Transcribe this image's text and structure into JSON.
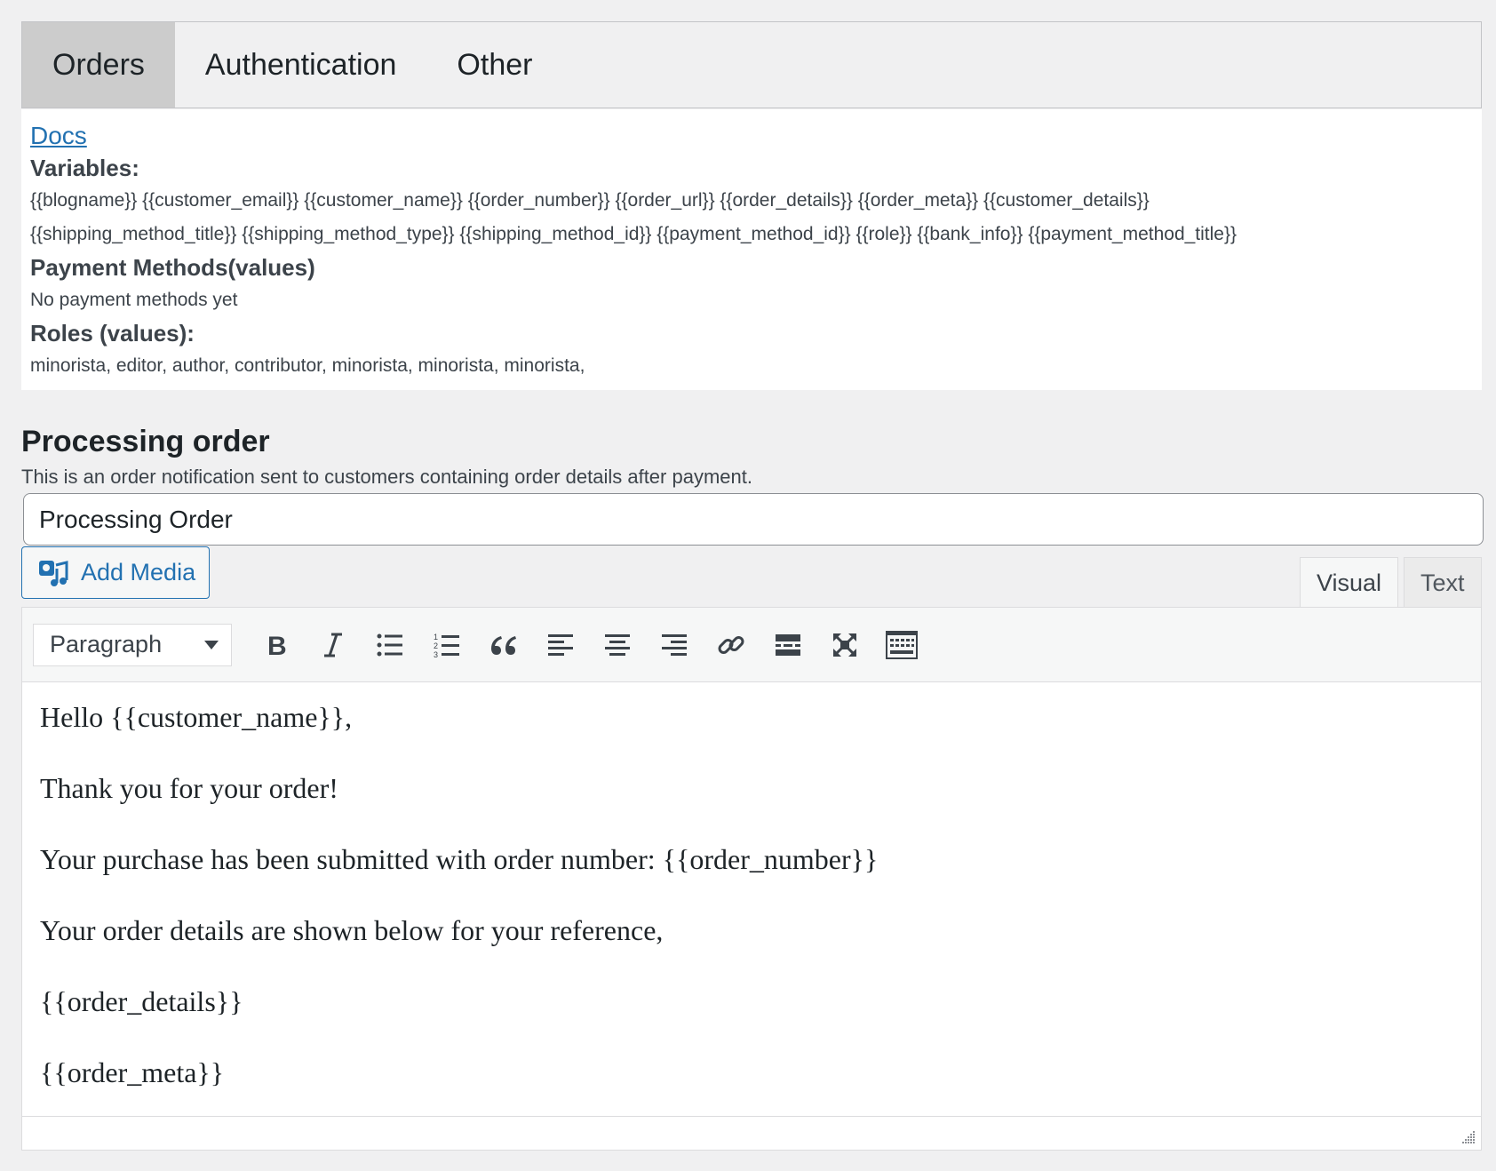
{
  "tabs": [
    {
      "label": "Orders",
      "active": true
    },
    {
      "label": "Authentication",
      "active": false
    },
    {
      "label": "Other",
      "active": false
    }
  ],
  "info": {
    "docs_link": "Docs",
    "variables_label": "Variables:",
    "variables_line1": "{{blogname}} {{customer_email}} {{customer_name}} {{order_number}} {{order_url}} {{order_details}} {{order_meta}} {{customer_details}}",
    "variables_line2": "{{shipping_method_title}} {{shipping_method_type}} {{shipping_method_id}} {{payment_method_id}} {{role}} {{bank_info}} {{payment_method_title}}",
    "payment_label": "Payment Methods(values)",
    "payment_value": "No payment methods yet",
    "roles_label": "Roles (values):",
    "roles_value": "minorista, editor, author, contributor, minorista, minorista, minorista,"
  },
  "section": {
    "title": "Processing order",
    "description": "This is an order notification sent to customers containing order details after payment."
  },
  "subject": {
    "value": "Processing Order"
  },
  "editor": {
    "add_media": "Add Media",
    "mode_visual": "Visual",
    "mode_text": "Text",
    "format": "Paragraph",
    "toolbar_icons": [
      "bold-icon",
      "italic-icon",
      "bullet-list-icon",
      "numbered-list-icon",
      "blockquote-icon",
      "align-left-icon",
      "align-center-icon",
      "align-right-icon",
      "link-icon",
      "read-more-icon",
      "fullscreen-icon",
      "toolbar-toggle-icon"
    ],
    "paragraphs": [
      "Hello {{customer_name}},",
      "Thank you for your order!",
      "Your purchase has been submitted with order number: {{order_number}}",
      "Your order details are shown below for your reference,",
      "{{order_details}}",
      "{{order_meta}}"
    ]
  },
  "colors": {
    "accent": "#2271b1",
    "background": "#f0f0f1",
    "active_tab": "#cccccc"
  }
}
